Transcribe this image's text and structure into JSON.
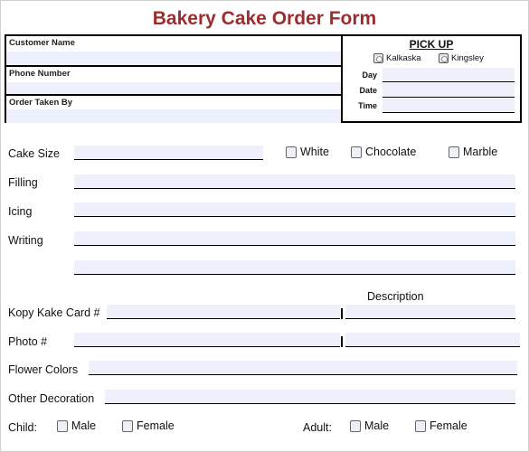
{
  "title": "Bakery Cake Order Form",
  "header": {
    "customer_name_label": "Customer Name",
    "phone_number_label": "Phone Number",
    "order_taken_by_label": "Order Taken By",
    "pickup": {
      "heading": "PICK UP",
      "locations": [
        "Kalkaska",
        "Kingsley"
      ],
      "day_label": "Day",
      "date_label": "Date",
      "time_label": "Time"
    }
  },
  "fields": {
    "cake_size": "Cake Size",
    "filling": "Filling",
    "icing": "Icing",
    "writing": "Writing",
    "description_heading": "Description",
    "kopy_kake_card": "Kopy Kake Card #",
    "photo": "Photo #",
    "flower_colors": "Flower Colors",
    "other_decoration": "Other Decoration"
  },
  "cake_flavors": [
    "White",
    "Chocolate",
    "Marble"
  ],
  "child": {
    "label": "Child:",
    "options": [
      "Male",
      "Female"
    ]
  },
  "adult": {
    "label": "Adult:",
    "options": [
      "Male",
      "Female"
    ]
  },
  "colors": {
    "title": "#9b2d2f",
    "field_fill": "#eef1fb"
  }
}
